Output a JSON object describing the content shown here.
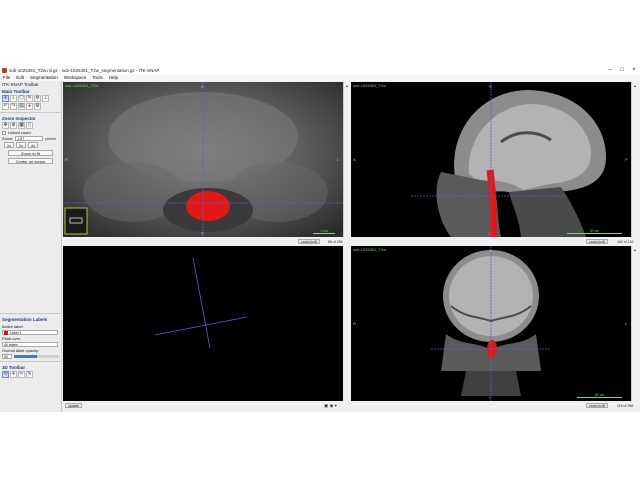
{
  "window": {
    "title": "sub-1025351_T2w.nii.gz - sub-1025351_T2w_segmentation.gz - ITK-SNAP",
    "minimize": "–",
    "maximize": "□",
    "close": "×"
  },
  "menu": [
    "File",
    "Edit",
    "Segmentation",
    "Workspace",
    "Tools",
    "Help"
  ],
  "sidebar": {
    "toolbar_panel_title": "ITK-SNAP Toolbar",
    "main_toolbar_title": "Main Toolbar",
    "main_tools": [
      "crosshair-icon",
      "zoom-icon",
      "polygon-icon",
      "paintbrush-icon",
      "snake-icon",
      "annotation-icon"
    ],
    "edit_tools": [
      "undo-icon",
      "redo-icon",
      "layers-icon",
      "paint-icon",
      "settings-icon"
    ],
    "zoom_inspector_title": "Zoom Inspector",
    "zoom_tools": [
      "pan-icon",
      "zoom-tool-icon",
      "grid-icon",
      "mouse-icon"
    ],
    "linked_zoom_label": "Linked zoom",
    "zoom_label": "Zoom:",
    "zoom_value": "1.87",
    "zoom_unit": "px/mm",
    "zoom_presets": [
      "1x",
      "2x",
      "4x"
    ],
    "zoom_to_fit": "Zoom to fit",
    "center_on_cursor": "Center on cursor",
    "seg_labels_title": "Segmentation Labels",
    "active_label_caption": "Active label:",
    "active_label": "Label 1",
    "paint_over_caption": "Paint over:",
    "paint_over": "All labels",
    "opacity_caption": "Overall label opacity:",
    "opacity_value": "50",
    "opacity_fraction": 0.5,
    "toolbar3d_title": "3D Toolbar",
    "tools3d": [
      "rotate-icon",
      "crosshair3d-icon",
      "scalpel-icon",
      "spray-icon"
    ]
  },
  "views": {
    "axial": {
      "label": "sub-1025351_T2w",
      "orient_top": "A",
      "orient_left": "R",
      "orient_right": "L",
      "orient_bottom": "P",
      "scale": "1 cm",
      "zoom_fit": "zoom to fit",
      "slice": "66 of 256"
    },
    "sagittal": {
      "label": "sub-1025351_T2w",
      "orient_top": "S",
      "orient_left": "A",
      "orient_right": "P",
      "orient_bottom": "I",
      "scale": "30 cm",
      "zoom_fit": "zoom to fit",
      "slice": "162 of 162"
    },
    "coronal": {
      "label": "sub-1025351_T2w",
      "orient_top": "S",
      "orient_left": "R",
      "orient_right": "L",
      "orient_bottom": "I",
      "scale": "30 cm",
      "zoom_fit": "zoom to fit",
      "slice": "115 of 256"
    },
    "view3d": {
      "update_button": "update"
    }
  },
  "colors": {
    "segmentation": "#e01818",
    "crosshair": "#5560d0",
    "label_text": "#7fd07f",
    "orientation_text": "#c9b96e"
  }
}
